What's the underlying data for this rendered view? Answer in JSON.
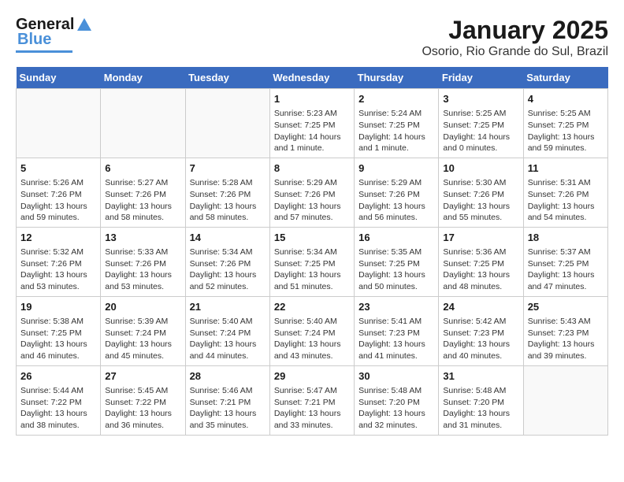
{
  "header": {
    "logo_general": "General",
    "logo_blue": "Blue",
    "title": "January 2025",
    "subtitle": "Osorio, Rio Grande do Sul, Brazil"
  },
  "days_of_week": [
    "Sunday",
    "Monday",
    "Tuesday",
    "Wednesday",
    "Thursday",
    "Friday",
    "Saturday"
  ],
  "weeks": [
    [
      {
        "day": "",
        "info": ""
      },
      {
        "day": "",
        "info": ""
      },
      {
        "day": "",
        "info": ""
      },
      {
        "day": "1",
        "info": "Sunrise: 5:23 AM\nSunset: 7:25 PM\nDaylight: 14 hours and 1 minute."
      },
      {
        "day": "2",
        "info": "Sunrise: 5:24 AM\nSunset: 7:25 PM\nDaylight: 14 hours and 1 minute."
      },
      {
        "day": "3",
        "info": "Sunrise: 5:25 AM\nSunset: 7:25 PM\nDaylight: 14 hours and 0 minutes."
      },
      {
        "day": "4",
        "info": "Sunrise: 5:25 AM\nSunset: 7:25 PM\nDaylight: 13 hours and 59 minutes."
      }
    ],
    [
      {
        "day": "5",
        "info": "Sunrise: 5:26 AM\nSunset: 7:26 PM\nDaylight: 13 hours and 59 minutes."
      },
      {
        "day": "6",
        "info": "Sunrise: 5:27 AM\nSunset: 7:26 PM\nDaylight: 13 hours and 58 minutes."
      },
      {
        "day": "7",
        "info": "Sunrise: 5:28 AM\nSunset: 7:26 PM\nDaylight: 13 hours and 58 minutes."
      },
      {
        "day": "8",
        "info": "Sunrise: 5:29 AM\nSunset: 7:26 PM\nDaylight: 13 hours and 57 minutes."
      },
      {
        "day": "9",
        "info": "Sunrise: 5:29 AM\nSunset: 7:26 PM\nDaylight: 13 hours and 56 minutes."
      },
      {
        "day": "10",
        "info": "Sunrise: 5:30 AM\nSunset: 7:26 PM\nDaylight: 13 hours and 55 minutes."
      },
      {
        "day": "11",
        "info": "Sunrise: 5:31 AM\nSunset: 7:26 PM\nDaylight: 13 hours and 54 minutes."
      }
    ],
    [
      {
        "day": "12",
        "info": "Sunrise: 5:32 AM\nSunset: 7:26 PM\nDaylight: 13 hours and 53 minutes."
      },
      {
        "day": "13",
        "info": "Sunrise: 5:33 AM\nSunset: 7:26 PM\nDaylight: 13 hours and 53 minutes."
      },
      {
        "day": "14",
        "info": "Sunrise: 5:34 AM\nSunset: 7:26 PM\nDaylight: 13 hours and 52 minutes."
      },
      {
        "day": "15",
        "info": "Sunrise: 5:34 AM\nSunset: 7:25 PM\nDaylight: 13 hours and 51 minutes."
      },
      {
        "day": "16",
        "info": "Sunrise: 5:35 AM\nSunset: 7:25 PM\nDaylight: 13 hours and 50 minutes."
      },
      {
        "day": "17",
        "info": "Sunrise: 5:36 AM\nSunset: 7:25 PM\nDaylight: 13 hours and 48 minutes."
      },
      {
        "day": "18",
        "info": "Sunrise: 5:37 AM\nSunset: 7:25 PM\nDaylight: 13 hours and 47 minutes."
      }
    ],
    [
      {
        "day": "19",
        "info": "Sunrise: 5:38 AM\nSunset: 7:25 PM\nDaylight: 13 hours and 46 minutes."
      },
      {
        "day": "20",
        "info": "Sunrise: 5:39 AM\nSunset: 7:24 PM\nDaylight: 13 hours and 45 minutes."
      },
      {
        "day": "21",
        "info": "Sunrise: 5:40 AM\nSunset: 7:24 PM\nDaylight: 13 hours and 44 minutes."
      },
      {
        "day": "22",
        "info": "Sunrise: 5:40 AM\nSunset: 7:24 PM\nDaylight: 13 hours and 43 minutes."
      },
      {
        "day": "23",
        "info": "Sunrise: 5:41 AM\nSunset: 7:23 PM\nDaylight: 13 hours and 41 minutes."
      },
      {
        "day": "24",
        "info": "Sunrise: 5:42 AM\nSunset: 7:23 PM\nDaylight: 13 hours and 40 minutes."
      },
      {
        "day": "25",
        "info": "Sunrise: 5:43 AM\nSunset: 7:23 PM\nDaylight: 13 hours and 39 minutes."
      }
    ],
    [
      {
        "day": "26",
        "info": "Sunrise: 5:44 AM\nSunset: 7:22 PM\nDaylight: 13 hours and 38 minutes."
      },
      {
        "day": "27",
        "info": "Sunrise: 5:45 AM\nSunset: 7:22 PM\nDaylight: 13 hours and 36 minutes."
      },
      {
        "day": "28",
        "info": "Sunrise: 5:46 AM\nSunset: 7:21 PM\nDaylight: 13 hours and 35 minutes."
      },
      {
        "day": "29",
        "info": "Sunrise: 5:47 AM\nSunset: 7:21 PM\nDaylight: 13 hours and 33 minutes."
      },
      {
        "day": "30",
        "info": "Sunrise: 5:48 AM\nSunset: 7:20 PM\nDaylight: 13 hours and 32 minutes."
      },
      {
        "day": "31",
        "info": "Sunrise: 5:48 AM\nSunset: 7:20 PM\nDaylight: 13 hours and 31 minutes."
      },
      {
        "day": "",
        "info": ""
      }
    ]
  ]
}
